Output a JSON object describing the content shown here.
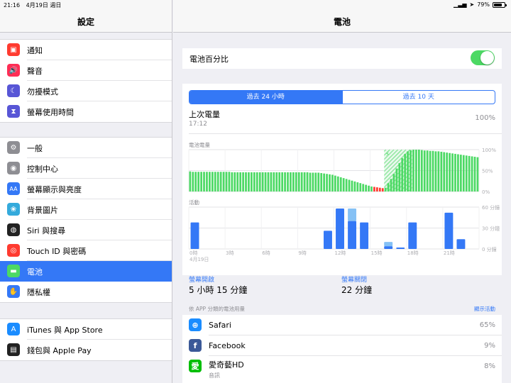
{
  "status_bar": {
    "time": "21:16",
    "date": "4月19日 週日",
    "battery_text": "79%",
    "battery_level": 0.79
  },
  "sidebar": {
    "title": "設定",
    "groups": [
      [
        {
          "label": "通知",
          "icon": "notifications-icon",
          "color": "#ff3b30"
        },
        {
          "label": "聲音",
          "icon": "sound-icon",
          "color": "#ff2d55"
        },
        {
          "label": "勿擾模式",
          "icon": "moon-icon",
          "color": "#5856d6"
        },
        {
          "label": "螢幕使用時間",
          "icon": "hourglass-icon",
          "color": "#5856d6"
        }
      ],
      [
        {
          "label": "一般",
          "icon": "gear-icon",
          "color": "#8e8e93"
        },
        {
          "label": "控制中心",
          "icon": "control-center-icon",
          "color": "#8e8e93"
        },
        {
          "label": "螢幕顯示與亮度",
          "icon": "display-icon",
          "color": "#3478f6"
        },
        {
          "label": "背景圖片",
          "icon": "wallpaper-icon",
          "color": "#34aadc"
        },
        {
          "label": "Siri 與搜尋",
          "icon": "siri-icon",
          "color": "#222"
        },
        {
          "label": "Touch ID 與密碼",
          "icon": "fingerprint-icon",
          "color": "#ff3b30"
        },
        {
          "label": "電池",
          "icon": "battery-icon",
          "color": "#4cd964",
          "selected": true
        },
        {
          "label": "隱私權",
          "icon": "hand-icon",
          "color": "#3478f6"
        }
      ],
      [
        {
          "label": "iTunes 與 App Store",
          "icon": "app-store-icon",
          "color": "#1a8cff"
        },
        {
          "label": "錢包與 Apple Pay",
          "icon": "wallet-icon",
          "color": "#222"
        }
      ]
    ]
  },
  "main": {
    "title": "電池",
    "percentage_toggle_label": "電池百分比",
    "percentage_toggle_on": true,
    "tabs": [
      "過去 24 小時",
      "過去 10 天"
    ],
    "selected_tab": 0,
    "last_charge_label": "上次電量",
    "last_charge_time": "17:12",
    "last_charge_percent": "100%",
    "battery_chart_label": "電池電量",
    "activity_chart_label": "活動",
    "screen_on_label": "螢幕開啟",
    "screen_on_value": "5 小時 15 分鐘",
    "screen_off_label": "螢幕關閉",
    "screen_off_value": "22 分鐘",
    "usage_by_app_label": "依 APP 分類的電池用量",
    "show_activity_label": "顯示活動",
    "apps": [
      {
        "name": "Safari",
        "sub": "",
        "percent": "65%",
        "icon": "safari-icon",
        "color": "#1a8cff",
        "glyph": "⊕"
      },
      {
        "name": "Facebook",
        "sub": "",
        "percent": "9%",
        "icon": "facebook-icon",
        "color": "#3b5998",
        "glyph": "f"
      },
      {
        "name": "愛奇藝HD",
        "sub": "音訊",
        "percent": "8%",
        "icon": "iqiyi-icon",
        "color": "#00be06",
        "glyph": "愛"
      }
    ]
  },
  "chart_data": [
    {
      "type": "bar",
      "title": "電池電量",
      "y_ticks": [
        "100%",
        "50%",
        "0%"
      ],
      "ylim": [
        0,
        100
      ],
      "colors": {
        "normal": "#4cd964",
        "low": "#ff3b30",
        "charging_hatch": "#4cd964"
      },
      "values": [
        48,
        47,
        47,
        47,
        47,
        47,
        47,
        47,
        47,
        47,
        47,
        47,
        47,
        47,
        47,
        46,
        46,
        46,
        46,
        46,
        46,
        46,
        46,
        46,
        46,
        46,
        46,
        46,
        46,
        46,
        46,
        46,
        46,
        46,
        46,
        46,
        46,
        46,
        46,
        46,
        46,
        46,
        46,
        45,
        45,
        45,
        45,
        44,
        43,
        42,
        41,
        40,
        38,
        36,
        34,
        32,
        30,
        28,
        26,
        24,
        22,
        20,
        18,
        16,
        14,
        12,
        11,
        10,
        9,
        8,
        9,
        20,
        30,
        42,
        55,
        68,
        80,
        90,
        96,
        99,
        100,
        100,
        100,
        99,
        98,
        98,
        97,
        97,
        96,
        96,
        95,
        94,
        93,
        92,
        91,
        90,
        89,
        88,
        87,
        86,
        85,
        84,
        83,
        82
      ],
      "low_indices": [
        66,
        67,
        68,
        69
      ],
      "charging_range": [
        70,
        80
      ]
    },
    {
      "type": "bar",
      "title": "活動",
      "y_ticks": [
        "60 分鐘",
        "30 分鐘",
        "0 分鐘"
      ],
      "ylim": [
        0,
        60
      ],
      "x_ticks": [
        "0時",
        "3時",
        "6時",
        "9時",
        "12時",
        "15時",
        "18時",
        "21時"
      ],
      "x_date": "4月19日",
      "categories": [
        0,
        1,
        2,
        3,
        4,
        5,
        6,
        7,
        8,
        9,
        10,
        11,
        12,
        13,
        14,
        15,
        16,
        17,
        18,
        19,
        20,
        21,
        22,
        23
      ],
      "series": [
        {
          "name": "screen_on",
          "color": "#3478f6",
          "values": [
            38,
            0,
            0,
            0,
            0,
            0,
            0,
            0,
            0,
            0,
            0,
            26,
            58,
            40,
            38,
            0,
            4,
            2,
            38,
            0,
            0,
            52,
            14,
            0
          ]
        },
        {
          "name": "screen_off",
          "color": "#85c1f5",
          "values": [
            0,
            0,
            0,
            0,
            0,
            0,
            0,
            0,
            0,
            0,
            0,
            0,
            0,
            18,
            0,
            0,
            6,
            0,
            0,
            0,
            0,
            0,
            0,
            0
          ]
        }
      ]
    }
  ]
}
